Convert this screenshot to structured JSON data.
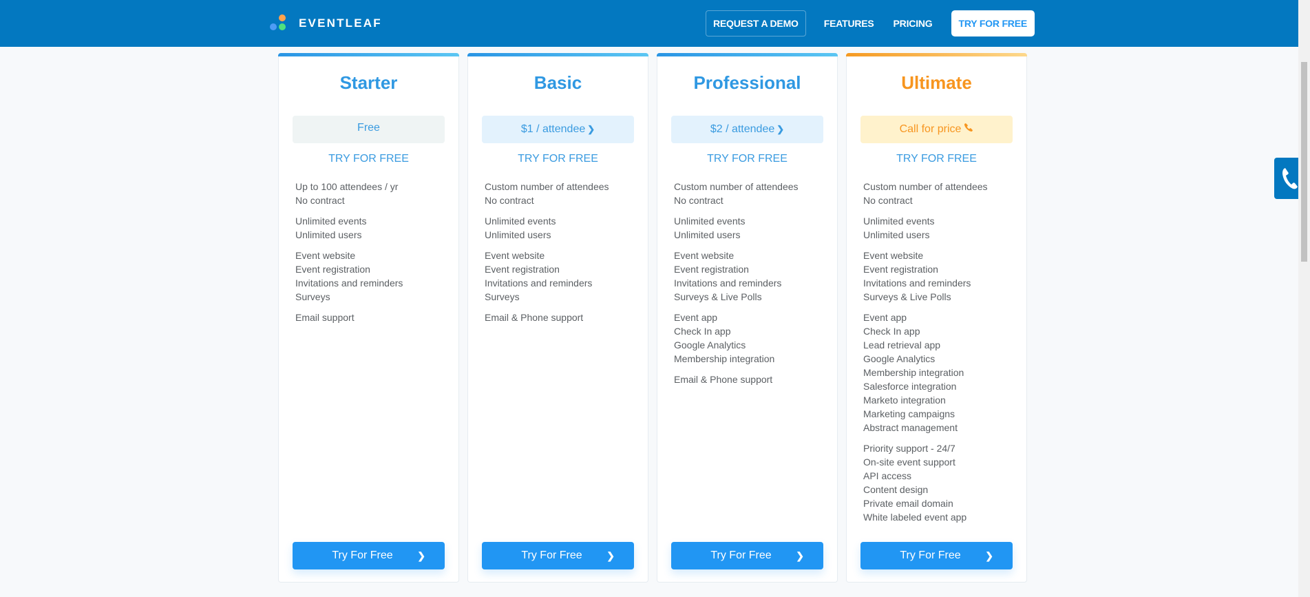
{
  "header": {
    "brand": "EVENTLEAF",
    "nav": {
      "request_demo": "REQUEST A DEMO",
      "features": "FEATURES",
      "pricing": "PRICING",
      "try_free": "TRY FOR FREE"
    }
  },
  "colors": {
    "header_bg": "#0378c0",
    "accent_blue": "#2196f3",
    "accent_orange": "#f7951f"
  },
  "plans": [
    {
      "name": "Starter",
      "price": "Free",
      "try_link": "TRY FOR FREE",
      "cta": "Try For Free",
      "feature_groups": [
        [
          "Up to 100 attendees / yr",
          "No contract"
        ],
        [
          "Unlimited events",
          "Unlimited users"
        ],
        [
          "Event website",
          "Event registration",
          "Invitations and reminders",
          "Surveys"
        ],
        [
          "Email support"
        ]
      ]
    },
    {
      "name": "Basic",
      "price": "$1 / attendee",
      "try_link": "TRY FOR FREE",
      "cta": "Try For Free",
      "feature_groups": [
        [
          "Custom number of attendees",
          "No contract"
        ],
        [
          "Unlimited events",
          "Unlimited users"
        ],
        [
          "Event website",
          "Event registration",
          "Invitations and reminders",
          "Surveys"
        ],
        [
          "Email & Phone support"
        ]
      ]
    },
    {
      "name": "Professional",
      "price": "$2 / attendee",
      "try_link": "TRY FOR FREE",
      "cta": "Try For Free",
      "feature_groups": [
        [
          "Custom number of attendees",
          "No contract"
        ],
        [
          "Unlimited events",
          "Unlimited users"
        ],
        [
          "Event website",
          "Event registration",
          "Invitations and reminders",
          "Surveys & Live Polls"
        ],
        [
          "Event app",
          "Check In app",
          "Google Analytics",
          "Membership integration"
        ],
        [
          "Email & Phone support"
        ]
      ]
    },
    {
      "name": "Ultimate",
      "price": "Call for price",
      "try_link": "TRY FOR FREE",
      "cta": "Try For Free",
      "feature_groups": [
        [
          "Custom number of attendees",
          "No contract"
        ],
        [
          "Unlimited events",
          "Unlimited users"
        ],
        [
          "Event website",
          "Event registration",
          "Invitations and reminders",
          "Surveys & Live Polls"
        ],
        [
          "Event app",
          "Check In app",
          "Lead retrieval app",
          "Google Analytics",
          "Membership integration",
          "Salesforce integration",
          "Marketo integration",
          "Marketing campaigns",
          "Abstract management"
        ],
        [
          "Priority support - 24/7",
          "On-site event support",
          "API access",
          "Content design",
          "Private email domain",
          "White labeled event app"
        ]
      ]
    }
  ],
  "icons": {
    "price_chevron": "chevron-right-icon",
    "call_price": "phone-icon",
    "cta_chevron": "chevron-right-icon",
    "side_widget": "phone-icon"
  }
}
